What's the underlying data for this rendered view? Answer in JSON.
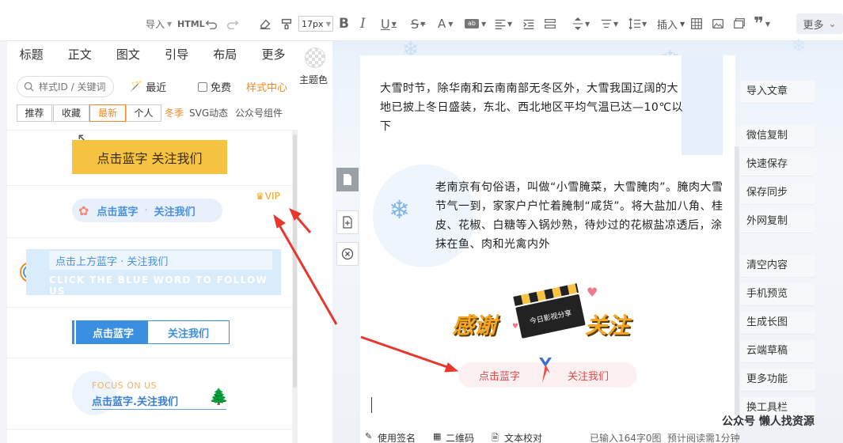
{
  "toolbar": {
    "import_label": "导入",
    "html_label": "HTML",
    "font_size": "17px",
    "insert_label": "插入",
    "more_label": "更多"
  },
  "left_tabs": [
    "标题",
    "正文",
    "图文",
    "引导",
    "布局",
    "更多"
  ],
  "search": {
    "placeholder": "样式ID / 关键词",
    "recent_label": "最近",
    "free_label": "免费",
    "style_center_label": "样式中心"
  },
  "filters": {
    "buttons": [
      "推荐",
      "收藏",
      "最新",
      "个人"
    ],
    "active": "最新",
    "tags": [
      "冬季",
      "SVG动态",
      "公众号组件"
    ]
  },
  "styles": {
    "item1_text": "点击蓝字 关注我们",
    "item2_left": "点击蓝字",
    "item2_dot": "·",
    "item2_right": "关注我们",
    "vip_label": "VIP",
    "item3_text": "点击上方蓝字 · 关注我们",
    "item3_en": "CLICK THE BLUE WORD TO FOLLOW US",
    "item4_left": "点击蓝字",
    "item4_right": "关注我们",
    "item5_en": "FOCUS ON US",
    "item5_text": "点击蓝字.关注我们"
  },
  "theme": {
    "label": "主题色"
  },
  "document": {
    "para1": "大雪时节，除华南和云南南部无冬区外，大雪我国辽阔的大地已披上冬日盛装，东北、西北地区平均气温已达—10℃以下",
    "para2": "老南京有句俗语，叫做“小雪腌菜，大雪腌肉”。腌肉大雪节气一到，家家户户忙着腌制“咸货”。将大盐加八角、桂皮、花椒、白糖等入锅炒熟，待炒过的花椒盐凉透后，涂抹在鱼、肉和光禽内外",
    "thanks_left": "感谢",
    "thanks_right": "关注",
    "clapper_label": "今日影视分享",
    "follow_left": "点击蓝字",
    "follow_right": "关注我们"
  },
  "right_buttons": [
    "导入文章",
    "微信复制",
    "快速保存",
    "保存同步",
    "外网复制",
    "清空内容",
    "手机预览",
    "生成长图",
    "云端草稿",
    "更多功能",
    "换工具栏"
  ],
  "status": {
    "sign": "使用签名",
    "qrcode": "二维码",
    "proofread": "文本校对",
    "count": "已输入164字0图",
    "read_time": "预计阅读需1分钟"
  },
  "watermark": "公众号 懒人找资源",
  "colors": {
    "accent_orange": "#f08a24",
    "blue": "#3b8fe0",
    "yellow": "#f6c343",
    "pink_red": "#e84a4a",
    "arrow_red": "#e8382e"
  }
}
